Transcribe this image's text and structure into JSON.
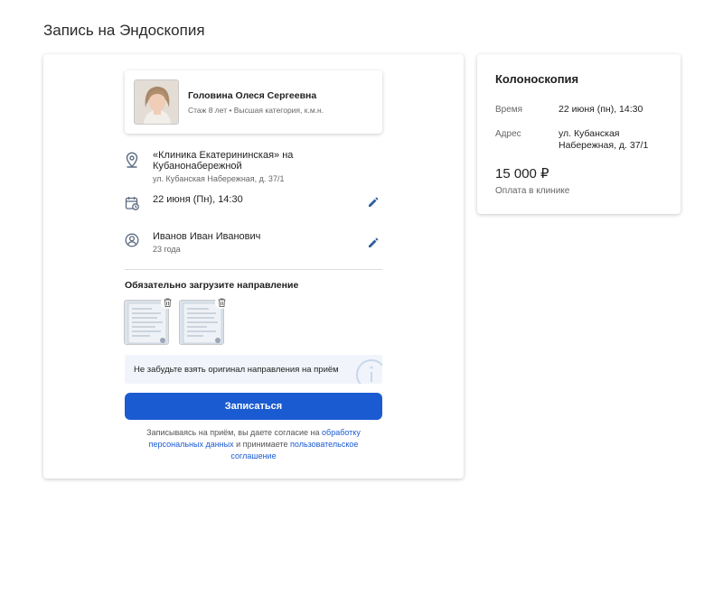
{
  "page": {
    "title": "Запись на Эндоскопия"
  },
  "doctor": {
    "name": "Головина Олеся Сергеевна",
    "subtitle": "Стаж 8 лет • Высшая категория, к.м.н."
  },
  "clinic": {
    "name": "«Клиника Екатерининская» на Кубанонабережной",
    "address": "ул. Кубанская Набережная, д. 37/1"
  },
  "appointment": {
    "datetime": "22 июня (Пн), 14:30"
  },
  "patient": {
    "name": "Иванов Иван Иванович",
    "age": "23 года"
  },
  "upload": {
    "title": "Обязательно загрузите направление"
  },
  "notice": {
    "text": "Не забудьте взять оригинал направления на приём"
  },
  "submit": {
    "label": "Записаться"
  },
  "consent": {
    "prefix": "Записываясь на приём, вы даете согласие на",
    "link1": "обработку персональных данных",
    "middle": "и принимаете",
    "link2": "пользовательское соглашение"
  },
  "summary": {
    "title": "Колоноскопия",
    "time_label": "Время",
    "time_value": "22 июня (пн), 14:30",
    "address_label": "Адрес",
    "address_value": "ул. Кубанская Набережная, д. 37/1",
    "price": "15 000 ₽",
    "payment": "Оплата в клинике"
  },
  "icons": {
    "location": "location-pin-icon",
    "calendar": "calendar-icon",
    "user": "user-circle-icon",
    "edit": "pencil-icon",
    "trash": "trash-icon",
    "info": "info-icon"
  },
  "colors": {
    "accent": "#1a5bd1",
    "notice_bg": "#f1f5fb",
    "icon": "#5b6b80"
  }
}
